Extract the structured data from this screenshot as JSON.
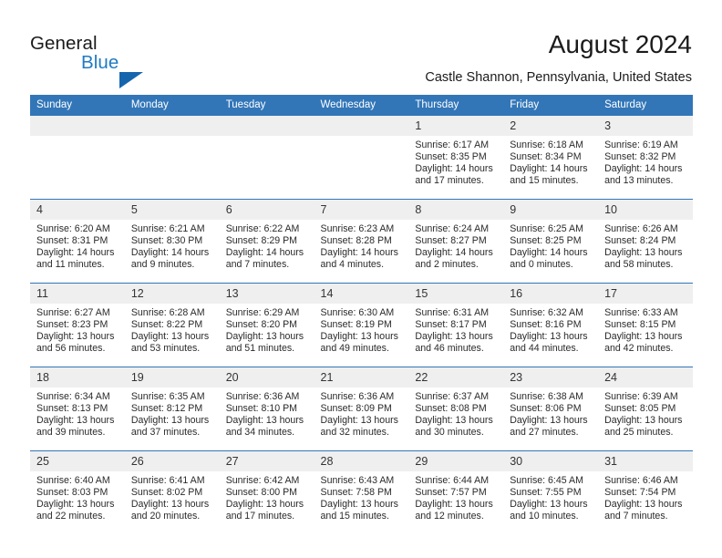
{
  "brand": {
    "name_part1": "General",
    "name_part2": "Blue",
    "triangle_color": "#1565ad",
    "blue_text_color": "#1f7ac4"
  },
  "header": {
    "title": "August 2024",
    "subtitle": "Castle Shannon, Pennsylvania, United States",
    "accent_color": "#3276b8",
    "daynum_band_color": "#efefef"
  },
  "weekday_headers": [
    "Sunday",
    "Monday",
    "Tuesday",
    "Wednesday",
    "Thursday",
    "Friday",
    "Saturday"
  ],
  "weeks": [
    [
      {
        "day": "",
        "sunrise": "",
        "sunset": "",
        "daylight1": "",
        "daylight2": ""
      },
      {
        "day": "",
        "sunrise": "",
        "sunset": "",
        "daylight1": "",
        "daylight2": ""
      },
      {
        "day": "",
        "sunrise": "",
        "sunset": "",
        "daylight1": "",
        "daylight2": ""
      },
      {
        "day": "",
        "sunrise": "",
        "sunset": "",
        "daylight1": "",
        "daylight2": ""
      },
      {
        "day": "1",
        "sunrise": "Sunrise: 6:17 AM",
        "sunset": "Sunset: 8:35 PM",
        "daylight1": "Daylight: 14 hours",
        "daylight2": "and 17 minutes."
      },
      {
        "day": "2",
        "sunrise": "Sunrise: 6:18 AM",
        "sunset": "Sunset: 8:34 PM",
        "daylight1": "Daylight: 14 hours",
        "daylight2": "and 15 minutes."
      },
      {
        "day": "3",
        "sunrise": "Sunrise: 6:19 AM",
        "sunset": "Sunset: 8:32 PM",
        "daylight1": "Daylight: 14 hours",
        "daylight2": "and 13 minutes."
      }
    ],
    [
      {
        "day": "4",
        "sunrise": "Sunrise: 6:20 AM",
        "sunset": "Sunset: 8:31 PM",
        "daylight1": "Daylight: 14 hours",
        "daylight2": "and 11 minutes."
      },
      {
        "day": "5",
        "sunrise": "Sunrise: 6:21 AM",
        "sunset": "Sunset: 8:30 PM",
        "daylight1": "Daylight: 14 hours",
        "daylight2": "and 9 minutes."
      },
      {
        "day": "6",
        "sunrise": "Sunrise: 6:22 AM",
        "sunset": "Sunset: 8:29 PM",
        "daylight1": "Daylight: 14 hours",
        "daylight2": "and 7 minutes."
      },
      {
        "day": "7",
        "sunrise": "Sunrise: 6:23 AM",
        "sunset": "Sunset: 8:28 PM",
        "daylight1": "Daylight: 14 hours",
        "daylight2": "and 4 minutes."
      },
      {
        "day": "8",
        "sunrise": "Sunrise: 6:24 AM",
        "sunset": "Sunset: 8:27 PM",
        "daylight1": "Daylight: 14 hours",
        "daylight2": "and 2 minutes."
      },
      {
        "day": "9",
        "sunrise": "Sunrise: 6:25 AM",
        "sunset": "Sunset: 8:25 PM",
        "daylight1": "Daylight: 14 hours",
        "daylight2": "and 0 minutes."
      },
      {
        "day": "10",
        "sunrise": "Sunrise: 6:26 AM",
        "sunset": "Sunset: 8:24 PM",
        "daylight1": "Daylight: 13 hours",
        "daylight2": "and 58 minutes."
      }
    ],
    [
      {
        "day": "11",
        "sunrise": "Sunrise: 6:27 AM",
        "sunset": "Sunset: 8:23 PM",
        "daylight1": "Daylight: 13 hours",
        "daylight2": "and 56 minutes."
      },
      {
        "day": "12",
        "sunrise": "Sunrise: 6:28 AM",
        "sunset": "Sunset: 8:22 PM",
        "daylight1": "Daylight: 13 hours",
        "daylight2": "and 53 minutes."
      },
      {
        "day": "13",
        "sunrise": "Sunrise: 6:29 AM",
        "sunset": "Sunset: 8:20 PM",
        "daylight1": "Daylight: 13 hours",
        "daylight2": "and 51 minutes."
      },
      {
        "day": "14",
        "sunrise": "Sunrise: 6:30 AM",
        "sunset": "Sunset: 8:19 PM",
        "daylight1": "Daylight: 13 hours",
        "daylight2": "and 49 minutes."
      },
      {
        "day": "15",
        "sunrise": "Sunrise: 6:31 AM",
        "sunset": "Sunset: 8:17 PM",
        "daylight1": "Daylight: 13 hours",
        "daylight2": "and 46 minutes."
      },
      {
        "day": "16",
        "sunrise": "Sunrise: 6:32 AM",
        "sunset": "Sunset: 8:16 PM",
        "daylight1": "Daylight: 13 hours",
        "daylight2": "and 44 minutes."
      },
      {
        "day": "17",
        "sunrise": "Sunrise: 6:33 AM",
        "sunset": "Sunset: 8:15 PM",
        "daylight1": "Daylight: 13 hours",
        "daylight2": "and 42 minutes."
      }
    ],
    [
      {
        "day": "18",
        "sunrise": "Sunrise: 6:34 AM",
        "sunset": "Sunset: 8:13 PM",
        "daylight1": "Daylight: 13 hours",
        "daylight2": "and 39 minutes."
      },
      {
        "day": "19",
        "sunrise": "Sunrise: 6:35 AM",
        "sunset": "Sunset: 8:12 PM",
        "daylight1": "Daylight: 13 hours",
        "daylight2": "and 37 minutes."
      },
      {
        "day": "20",
        "sunrise": "Sunrise: 6:36 AM",
        "sunset": "Sunset: 8:10 PM",
        "daylight1": "Daylight: 13 hours",
        "daylight2": "and 34 minutes."
      },
      {
        "day": "21",
        "sunrise": "Sunrise: 6:36 AM",
        "sunset": "Sunset: 8:09 PM",
        "daylight1": "Daylight: 13 hours",
        "daylight2": "and 32 minutes."
      },
      {
        "day": "22",
        "sunrise": "Sunrise: 6:37 AM",
        "sunset": "Sunset: 8:08 PM",
        "daylight1": "Daylight: 13 hours",
        "daylight2": "and 30 minutes."
      },
      {
        "day": "23",
        "sunrise": "Sunrise: 6:38 AM",
        "sunset": "Sunset: 8:06 PM",
        "daylight1": "Daylight: 13 hours",
        "daylight2": "and 27 minutes."
      },
      {
        "day": "24",
        "sunrise": "Sunrise: 6:39 AM",
        "sunset": "Sunset: 8:05 PM",
        "daylight1": "Daylight: 13 hours",
        "daylight2": "and 25 minutes."
      }
    ],
    [
      {
        "day": "25",
        "sunrise": "Sunrise: 6:40 AM",
        "sunset": "Sunset: 8:03 PM",
        "daylight1": "Daylight: 13 hours",
        "daylight2": "and 22 minutes."
      },
      {
        "day": "26",
        "sunrise": "Sunrise: 6:41 AM",
        "sunset": "Sunset: 8:02 PM",
        "daylight1": "Daylight: 13 hours",
        "daylight2": "and 20 minutes."
      },
      {
        "day": "27",
        "sunrise": "Sunrise: 6:42 AM",
        "sunset": "Sunset: 8:00 PM",
        "daylight1": "Daylight: 13 hours",
        "daylight2": "and 17 minutes."
      },
      {
        "day": "28",
        "sunrise": "Sunrise: 6:43 AM",
        "sunset": "Sunset: 7:58 PM",
        "daylight1": "Daylight: 13 hours",
        "daylight2": "and 15 minutes."
      },
      {
        "day": "29",
        "sunrise": "Sunrise: 6:44 AM",
        "sunset": "Sunset: 7:57 PM",
        "daylight1": "Daylight: 13 hours",
        "daylight2": "and 12 minutes."
      },
      {
        "day": "30",
        "sunrise": "Sunrise: 6:45 AM",
        "sunset": "Sunset: 7:55 PM",
        "daylight1": "Daylight: 13 hours",
        "daylight2": "and 10 minutes."
      },
      {
        "day": "31",
        "sunrise": "Sunrise: 6:46 AM",
        "sunset": "Sunset: 7:54 PM",
        "daylight1": "Daylight: 13 hours",
        "daylight2": "and 7 minutes."
      }
    ]
  ]
}
